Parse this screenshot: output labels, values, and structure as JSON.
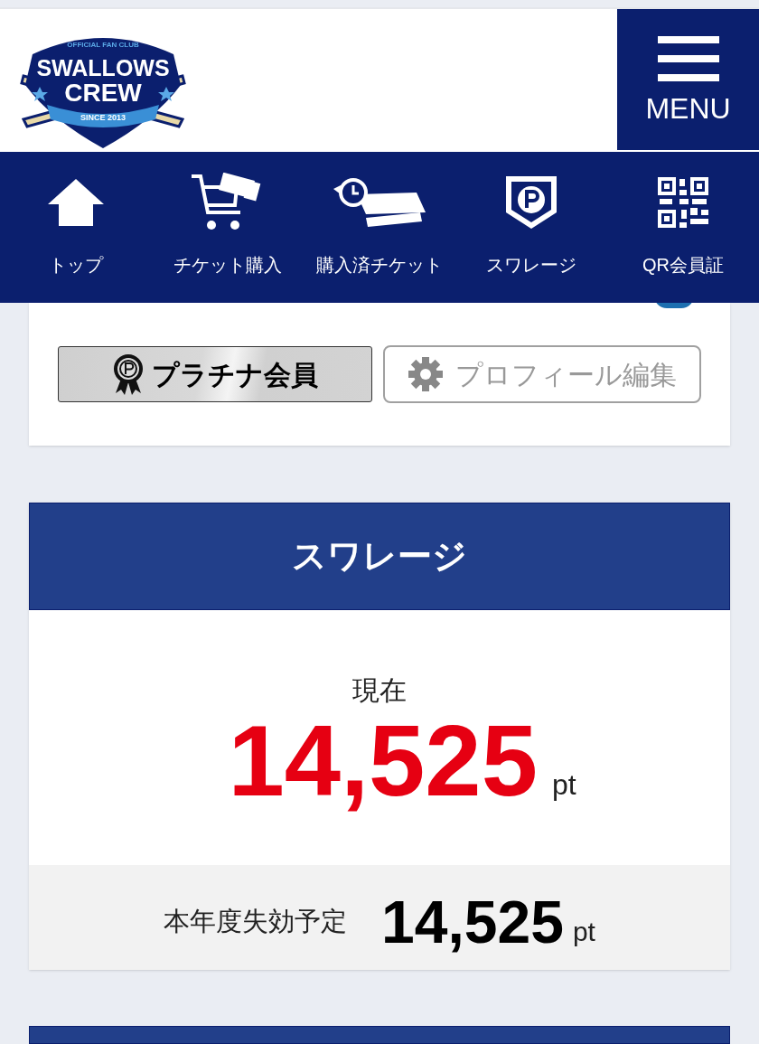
{
  "logo": {
    "top_text": "OFFICIAL FAN CLUB",
    "line_1": "SWALLOWS",
    "line_2": "CREW",
    "ribbon": "SINCE 2013"
  },
  "menu_button": {
    "label": "MENU"
  },
  "nav": [
    {
      "kind": "home",
      "label": "トップ"
    },
    {
      "kind": "cart",
      "label": "チケット購入"
    },
    {
      "kind": "history",
      "label": "購入済チケット"
    },
    {
      "kind": "points",
      "label": "スワレージ"
    },
    {
      "kind": "qr",
      "label": "QR会員証"
    }
  ],
  "profile": {
    "rank_badge": "プラチナ会員",
    "edit_button": "プロフィール編集"
  },
  "points_card": {
    "title": "スワレージ",
    "current_label": "現在",
    "current_value": "14,525",
    "current_unit": "pt",
    "expiring_label": "本年度失効予定",
    "expiring_value": "14,525",
    "expiring_unit": "pt"
  }
}
